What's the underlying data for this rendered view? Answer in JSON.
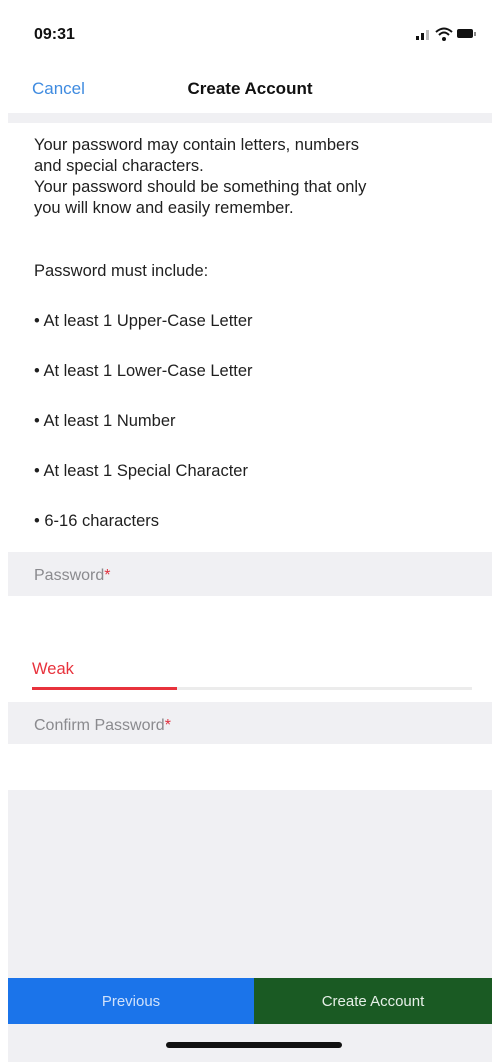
{
  "status_bar": {
    "time": "09:31",
    "icons": [
      "signal-icon",
      "wifi-icon",
      "battery-icon"
    ]
  },
  "nav": {
    "cancel_label": "Cancel",
    "title": "Create Account"
  },
  "info": {
    "lines": [
      "Your password may contain letters, numbers",
      "and special characters.",
      "Your password should be something that only",
      "you will know and easily remember."
    ]
  },
  "requirements": {
    "heading": "Password must include:",
    "items": [
      "• At least 1 Upper-Case Letter",
      "• At least 1 Lower-Case Letter",
      "• At least 1 Number",
      "• At least 1 Special Character",
      "• 6-16 characters"
    ]
  },
  "password_field": {
    "label": "Password",
    "required_mark": "*",
    "value": "",
    "strength_label": "Weak",
    "strength_fraction": 0.33
  },
  "confirm_field": {
    "label": "Confirm Password",
    "required_mark": "*",
    "value": ""
  },
  "footer": {
    "previous_label": "Previous",
    "create_label": "Create Account"
  },
  "colors": {
    "accent_blue": "#1b74ea",
    "create_green": "#1a5a23",
    "weak_red": "#e8323c",
    "link_blue": "#3f8be0"
  }
}
